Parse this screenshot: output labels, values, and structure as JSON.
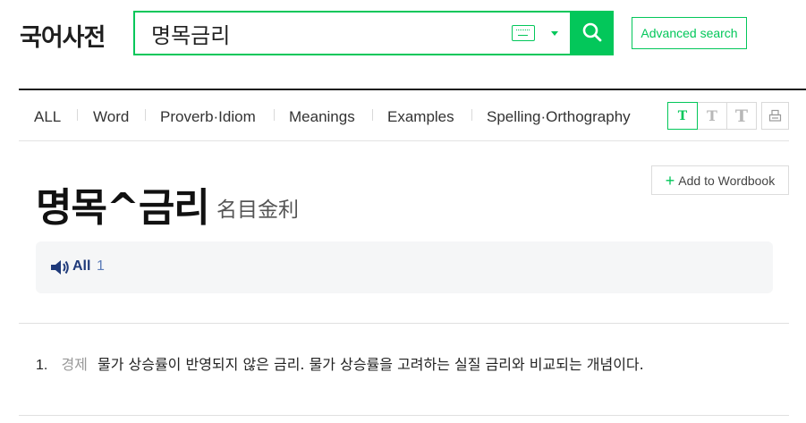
{
  "logo": {
    "text": "국어사전"
  },
  "search": {
    "value": "명목금리"
  },
  "advanced_search": {
    "label": "Advanced search"
  },
  "tabs": [
    {
      "label": "ALL"
    },
    {
      "label": "Word"
    },
    {
      "label": "Proverb·Idiom"
    },
    {
      "label": "Meanings"
    },
    {
      "label": "Examples"
    },
    {
      "label": "Spelling·Orthography"
    }
  ],
  "font_size_buttons": [
    {
      "label": "T"
    },
    {
      "label": "T"
    },
    {
      "label": "T"
    }
  ],
  "wordbook": {
    "plus": "+",
    "label": "Add to Wordbook"
  },
  "entry": {
    "headword": "명목^금리",
    "hanja": "名目金利",
    "pronunciation": {
      "label": "All",
      "count": "1"
    },
    "definitions": [
      {
        "num": "1.",
        "field": "경제",
        "text": "물가 상승률이 반영되지 않은 금리. 물가 상승률을 고려하는 실질 금리와 비교되는 개념이다."
      }
    ]
  },
  "icons": [
    "keyboard-icon",
    "chevron-down-icon",
    "search-icon",
    "print-icon",
    "speaker-icon"
  ],
  "colors": {
    "accent": "#03c75a",
    "pron_label": "#1f3a7a",
    "pron_count": "#5b7bb8"
  }
}
